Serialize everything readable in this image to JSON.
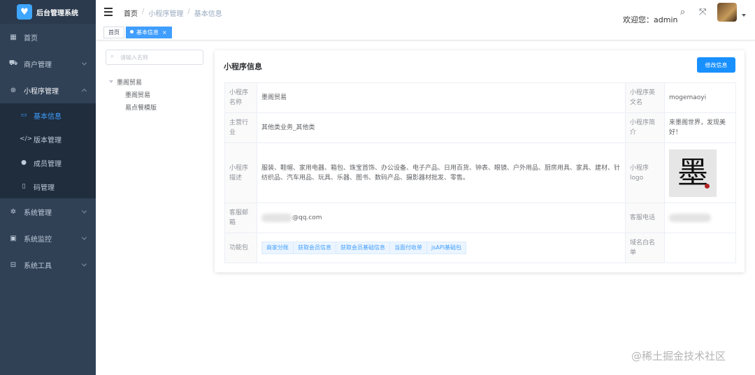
{
  "app": {
    "title": "后台管理系统",
    "logo_icon": "heart-icon",
    "accent": "#409eff"
  },
  "sidebar": {
    "items": [
      {
        "label": "首页",
        "icon": "dashboard-icon"
      },
      {
        "label": "商户管理",
        "icon": "bus-icon"
      },
      {
        "label": "小程序管理",
        "icon": "plus-circle-icon"
      },
      {
        "label": "系统管理",
        "icon": "gear-icon"
      },
      {
        "label": "系统监控",
        "icon": "monitor-icon"
      },
      {
        "label": "系统工具",
        "icon": "toolbox-icon"
      }
    ],
    "submenu": [
      {
        "label": "基本信息",
        "icon": "screen-icon"
      },
      {
        "label": "版本管理",
        "icon": "code-icon"
      },
      {
        "label": "成员管理",
        "icon": "user-icon"
      },
      {
        "label": "码管理",
        "icon": "phone-icon"
      }
    ]
  },
  "header": {
    "breadcrumb": [
      "首页",
      "小程序管理",
      "基本信息"
    ],
    "welcome": "欢迎您：admin"
  },
  "tags": {
    "home": "首页",
    "active": "基本信息"
  },
  "tree": {
    "search_placeholder": "请输入名称",
    "root": "墨阁贸易",
    "children": [
      "墨阁贸易",
      "易点餐模版"
    ]
  },
  "card": {
    "title": "小程序信息",
    "edit_label": "修改信息",
    "rows": {
      "name_label": "小程序名称",
      "name_value": "墨阁贸易",
      "en_label": "小程序英文名",
      "en_value": "mogemaoyi",
      "industry_label": "主营行业",
      "industry_value": "其他类业务_其他类",
      "intro_label": "小程序简介",
      "intro_value": "来墨阁世界，发现美好！",
      "desc_label": "小程序描述",
      "desc_value": "服装、鞋帽、家用电器、箱包、珠宝首饰、办公设备、电子产品、日用百货、钟表、眼镜、户外用品、厨房用具、家具、建材、针纺织品、汽车用品、玩具、乐器、图书、数码产品、摄影器材批发、零售。",
      "logo_label": "小程序logo",
      "logo_char": "墨",
      "email_label": "客服邮箱",
      "email_value": "@qq.com",
      "phone_label": "客服电话",
      "features_label": "功能包",
      "features": [
        "商家分账",
        "获取会员信息",
        "获取会员基础信息",
        "当面付收单",
        "jsAPI基础包"
      ],
      "domain_label": "域名白名单"
    }
  },
  "watermark": "@稀土掘金技术社区"
}
